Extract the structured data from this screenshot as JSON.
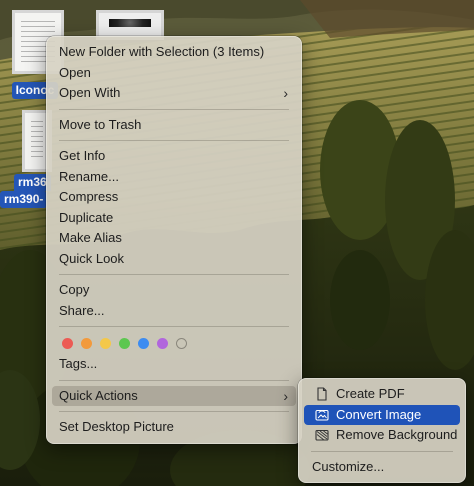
{
  "desktop": {
    "icons": [
      {
        "label": "Iconoc"
      },
      {
        "label": ""
      },
      {
        "label_line1": "rm36",
        "label_line2": "rm390-"
      }
    ]
  },
  "context_menu": {
    "items": {
      "new_folder": "New Folder with Selection (3 Items)",
      "open": "Open",
      "open_with": "Open With",
      "move_to_trash": "Move to Trash",
      "get_info": "Get Info",
      "rename": "Rename...",
      "compress": "Compress",
      "duplicate": "Duplicate",
      "make_alias": "Make Alias",
      "quick_look": "Quick Look",
      "copy": "Copy",
      "share": "Share...",
      "tags": "Tags...",
      "quick_actions": "Quick Actions",
      "set_desktop_picture": "Set Desktop Picture"
    },
    "chevron": "›",
    "tag_colors": [
      "#ec5b54",
      "#f29a3c",
      "#f4c84a",
      "#5cc74f",
      "#3d8cf0",
      "#b166dd",
      "empty"
    ]
  },
  "submenu": {
    "items": {
      "create_pdf": "Create PDF",
      "convert_image": "Convert Image",
      "remove_background": "Remove Background",
      "customize": "Customize..."
    },
    "icons": {
      "create_pdf": "document-icon",
      "convert_image": "photo-convert-icon",
      "remove_background": "photo-remove-background-icon"
    }
  },
  "colors": {
    "selection": "#1f53b8",
    "menu_bg": "#d6d2c4"
  }
}
